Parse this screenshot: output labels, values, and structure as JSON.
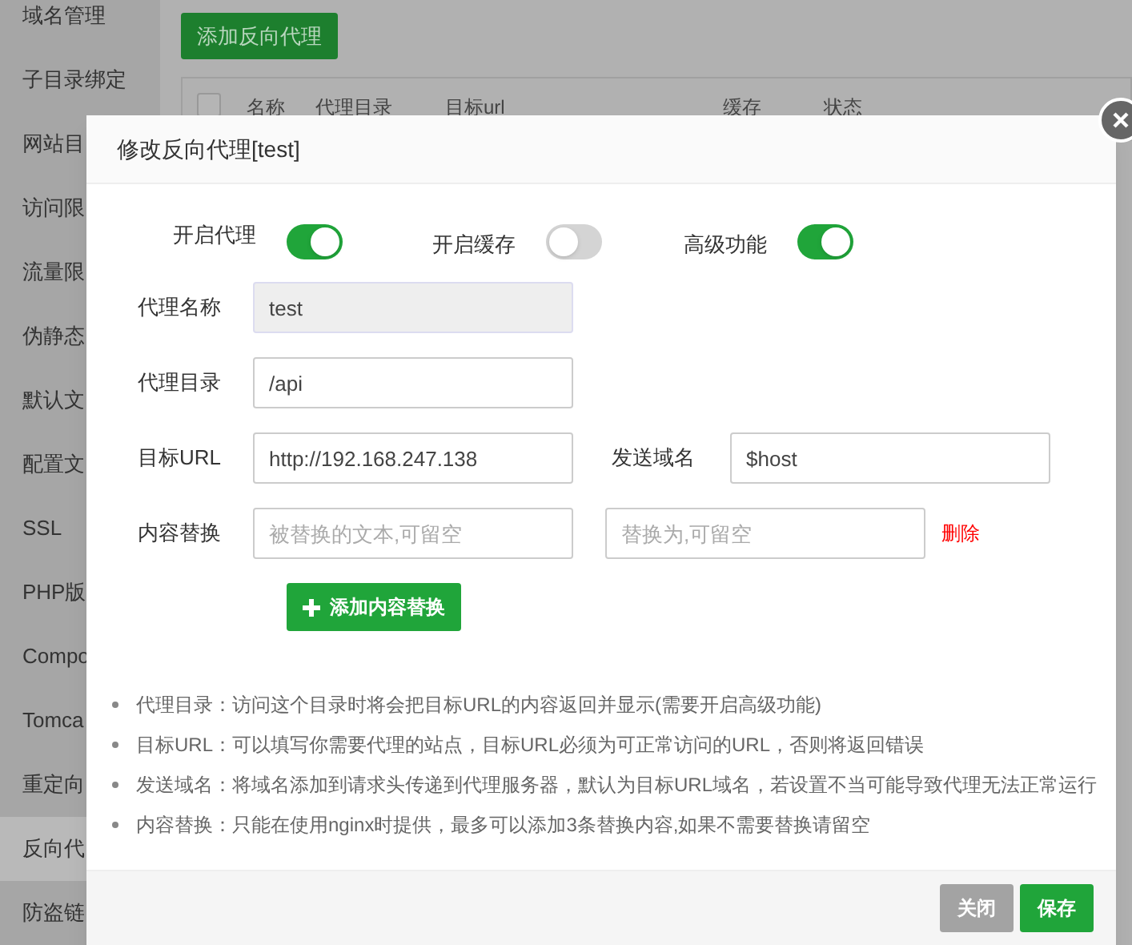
{
  "sidebar": {
    "items": [
      {
        "label": "域名管理",
        "selected": false
      },
      {
        "label": "子目录绑定",
        "selected": false
      },
      {
        "label": "网站目",
        "selected": false
      },
      {
        "label": "访问限",
        "selected": false
      },
      {
        "label": "流量限",
        "selected": false
      },
      {
        "label": "伪静态",
        "selected": false
      },
      {
        "label": "默认文",
        "selected": false
      },
      {
        "label": "配置文",
        "selected": false
      },
      {
        "label": "SSL",
        "selected": false
      },
      {
        "label": "PHP版",
        "selected": false
      },
      {
        "label": "Compo",
        "selected": false
      },
      {
        "label": "Tomca",
        "selected": false
      },
      {
        "label": "重定向",
        "selected": false
      },
      {
        "label": "反向代",
        "selected": true
      },
      {
        "label": "防盗链",
        "selected": false
      }
    ]
  },
  "toolbar": {
    "add_button": "添加反向代理"
  },
  "table": {
    "select_all_checked": false,
    "columns": [
      "名称",
      "代理目录",
      "目标url",
      "缓存",
      "状态"
    ]
  },
  "dialog": {
    "title": "修改反向代理[test]",
    "toggles": [
      {
        "label": "开启代理",
        "on": true
      },
      {
        "label": "开启缓存",
        "on": false
      },
      {
        "label": "高级功能",
        "on": true
      }
    ],
    "rows": [
      {
        "label": "代理名称",
        "fields": [
          {
            "value": "test",
            "disabled": true
          }
        ]
      },
      {
        "label": "代理目录",
        "fields": [
          {
            "value": "/api",
            "disabled": false
          }
        ]
      },
      {
        "label": "目标URL",
        "fields": [
          {
            "value": "http://192.168.247.138",
            "disabled": false
          },
          {
            "label": "发送域名",
            "value": "$host",
            "disabled": false
          }
        ]
      },
      {
        "label": "内容替换",
        "fields": [
          {
            "placeholder": "被替换的文本,可留空",
            "disabled": false
          },
          {
            "placeholder": "替换为,可留空",
            "disabled": false
          }
        ],
        "delete": "删除"
      }
    ],
    "add_replace_button": "添加内容替换",
    "notes": [
      "代理目录：访问这个目录时将会把目标URL的内容返回并显示(需要开启高级功能)",
      "目标URL：可以填写你需要代理的站点，目标URL必须为可正常访问的URL，否则将返回错误",
      "发送域名：将域名添加到请求头传递到代理服务器，默认为目标URL域名，若设置不当可能导致代理无法正常运行",
      "内容替换：只能在使用nginx时提供，最多可以添加3条替换内容,如果不需要替换请留空"
    ],
    "buttons": [
      {
        "label": "关闭",
        "kind": "secondary"
      },
      {
        "label": "保存",
        "kind": "primary"
      }
    ]
  }
}
